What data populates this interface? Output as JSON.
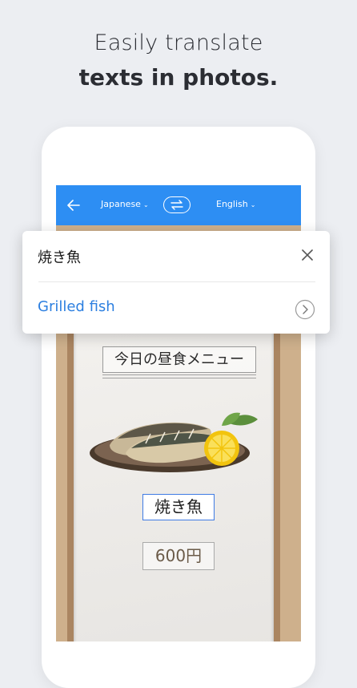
{
  "headline": {
    "line1": "Easily translate",
    "line2": "texts in photos."
  },
  "toolbar": {
    "source_language": "Japanese",
    "target_language": "English",
    "back_icon": "arrow-left",
    "swap_icon": "swap-arrows",
    "chevron_icon": "chevron-down",
    "accent_color": "#2d8ef3"
  },
  "menu": {
    "title": "今日の昼食メニュー",
    "dish": "焼き魚",
    "price": "600円"
  },
  "popup": {
    "source_text": "焼き魚",
    "translation": "Grilled fish",
    "close_icon": "close-x",
    "more_icon": "chevron-right-circle"
  }
}
